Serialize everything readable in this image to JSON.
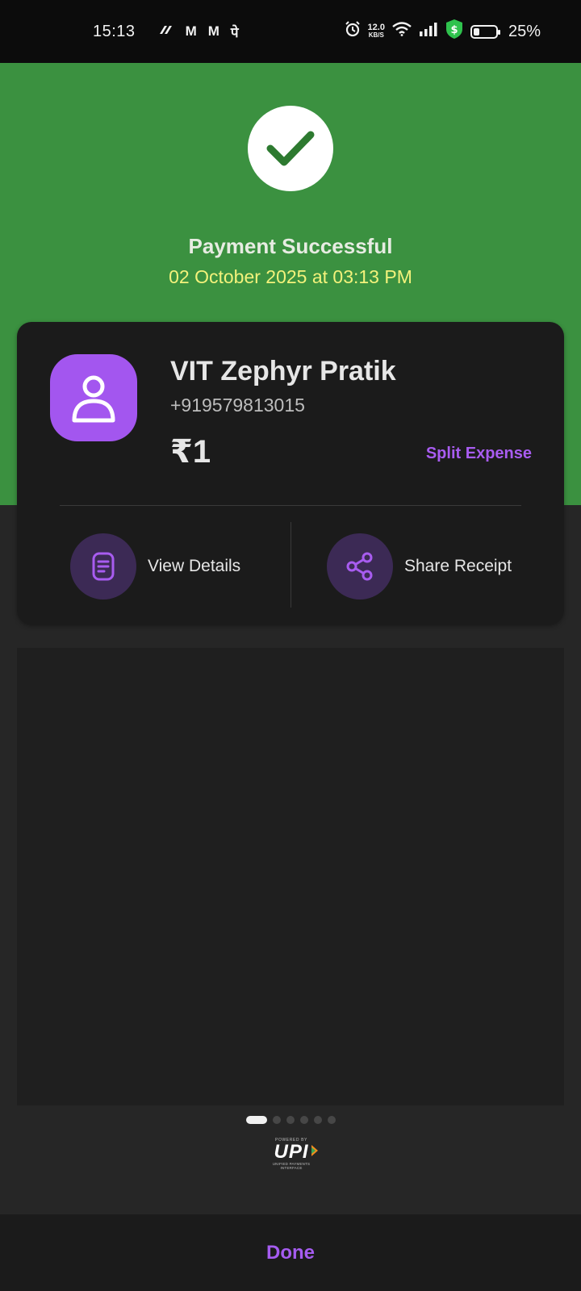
{
  "status_bar": {
    "time": "15:13",
    "app_icons": [
      "paytm-icon",
      "gmail-icon",
      "gmail-icon",
      "phonepe-icon"
    ],
    "app_glyphs": [
      "M",
      "M",
      "पे"
    ],
    "net_speed": "12.0",
    "net_speed_unit": "KB/S",
    "battery": "25%"
  },
  "hero": {
    "title": "Payment Successful",
    "datetime": "02 October 2025 at 03:13 PM",
    "bg_color": "#3b9140",
    "check_color": "#2d7a30"
  },
  "payee": {
    "name": "VIT Zephyr Pratik",
    "phone": "+919579813015",
    "amount": "₹1",
    "split_label": "Split Expense",
    "avatar_color": "#a356ef"
  },
  "actions": {
    "view_details": "View Details",
    "share_receipt": "Share Receipt"
  },
  "carousel": {
    "pages": 6,
    "active": 0
  },
  "upi": {
    "powered_by": "POWERED BY",
    "mark": "UPI",
    "subtitle": "UNIFIED PAYMENTS INTERFACE"
  },
  "footer": {
    "done_label": "Done"
  }
}
